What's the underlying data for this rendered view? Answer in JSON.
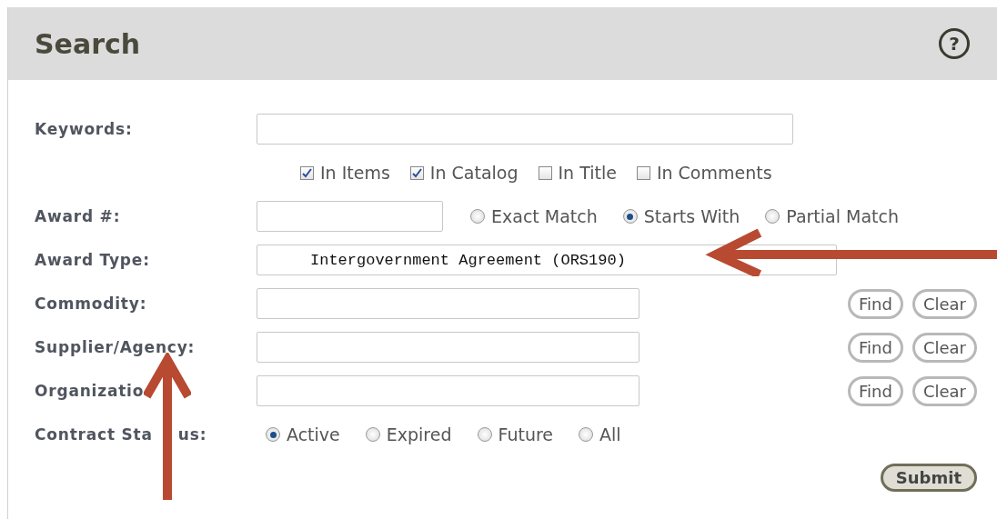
{
  "header": {
    "title": "Search",
    "help": "?"
  },
  "rows": [
    {
      "kind": "field",
      "label": "Keywords:",
      "value": ""
    },
    {
      "kind": "checks",
      "options": [
        {
          "label": "In Items",
          "checked": true
        },
        {
          "label": "In Catalog",
          "checked": true
        },
        {
          "label": "In Title",
          "checked": false
        },
        {
          "label": "In Comments",
          "checked": false
        }
      ]
    },
    {
      "kind": "match",
      "label": "Award #:",
      "value": "",
      "options": [
        {
          "label": "Exact Match",
          "selected": false
        },
        {
          "label": "Starts With",
          "selected": true
        },
        {
          "label": "Partial Match",
          "selected": false
        }
      ]
    },
    {
      "kind": "longfield",
      "label": "Award Type:",
      "value": "Intergovernment Agreement (ORS190)"
    },
    {
      "kind": "lookup",
      "label": "Commodity:",
      "value": "",
      "buttons": [
        "Find",
        "Clear"
      ]
    },
    {
      "kind": "lookup",
      "label": "Supplier/Agency:",
      "value": "",
      "buttons": [
        "Find",
        "Clear"
      ]
    },
    {
      "kind": "lookup",
      "label": "Organizatio",
      "value": "",
      "buttons": [
        "Find",
        "Clear"
      ]
    },
    {
      "kind": "radios",
      "label": "Contract Sta",
      "label_rest": "us:",
      "options": [
        {
          "label": "Active",
          "selected": true
        },
        {
          "label": "Expired",
          "selected": false
        },
        {
          "label": "Future",
          "selected": false
        },
        {
          "label": "All",
          "selected": false
        }
      ]
    }
  ],
  "submit": "Submit"
}
